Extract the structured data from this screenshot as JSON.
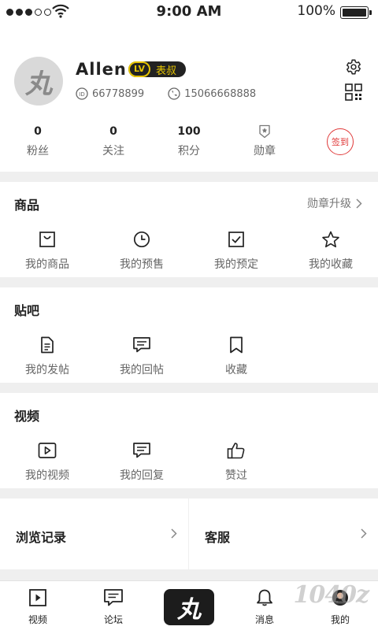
{
  "status_bar": {
    "time": "9:00 AM",
    "battery": "100%"
  },
  "profile": {
    "username": "Allen",
    "level_tag": "LV",
    "level_title": "表叔",
    "id_value": "66778899",
    "phone": "15066668888",
    "avatar_char": "丸",
    "stats": [
      {
        "value": "0",
        "label": "粉丝"
      },
      {
        "value": "0",
        "label": "关注"
      },
      {
        "value": "100",
        "label": "积分"
      },
      {
        "value": "",
        "label": "勋章"
      }
    ],
    "checkin_label": "签到"
  },
  "goods": {
    "title": "商品",
    "link": "勋章升级",
    "items": [
      {
        "label": "我的商品",
        "icon": "bag-icon"
      },
      {
        "label": "我的预售",
        "icon": "clock-icon"
      },
      {
        "label": "我的预定",
        "icon": "checkbox-icon"
      },
      {
        "label": "我的收藏",
        "icon": "star-icon"
      }
    ]
  },
  "forum": {
    "title": "贴吧",
    "items": [
      {
        "label": "我的发帖",
        "icon": "document-icon"
      },
      {
        "label": "我的回帖",
        "icon": "comment-icon"
      },
      {
        "label": "收藏",
        "icon": "bookmark-icon"
      }
    ]
  },
  "video": {
    "title": "视频",
    "items": [
      {
        "label": "我的视频",
        "icon": "play-icon"
      },
      {
        "label": "我的回复",
        "icon": "comment-icon"
      },
      {
        "label": "赞过",
        "icon": "thumbs-up-icon"
      }
    ]
  },
  "shortcuts": {
    "history": "浏览记录",
    "service": "客服"
  },
  "tabbar": {
    "tabs": [
      {
        "label": "视频",
        "icon": "video-tab-icon"
      },
      {
        "label": "论坛",
        "icon": "forum-tab-icon"
      },
      {
        "label": "",
        "icon": "logo-tab-icon"
      },
      {
        "label": "消息",
        "icon": "bell-icon"
      },
      {
        "label": "我的",
        "icon": "user-icon"
      }
    ],
    "logo_char": "丸"
  },
  "watermark": "1040z"
}
